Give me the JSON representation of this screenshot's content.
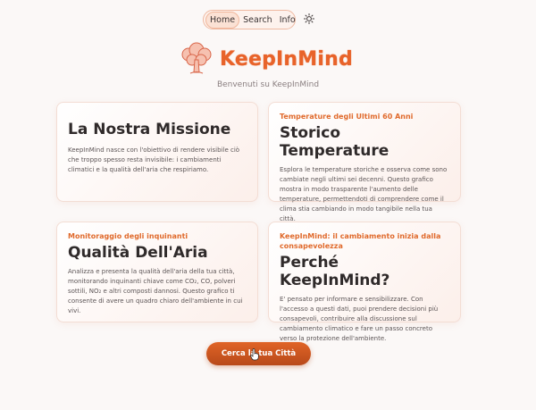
{
  "nav": {
    "items": [
      {
        "label": "Home",
        "active": true
      },
      {
        "label": "Search",
        "active": false
      },
      {
        "label": "Info",
        "active": false
      }
    ],
    "theme_toggle_icon": "sun-icon"
  },
  "header": {
    "logo_icon": "tree-cloud-icon",
    "brand": "KeepInMind",
    "welcome": "Benvenuti su KeepInMind"
  },
  "cards": [
    {
      "subtitle": "",
      "title": "La Nostra Missione",
      "body": "KeepInMind nasce con l'obiettivo di rendere visibile ciò che troppo spesso resta invisibile: i cambiamenti climatici e la qualità dell'aria che respiriamo."
    },
    {
      "subtitle": "Temperature degli Ultimi 60 Anni",
      "title": "Storico Temperature",
      "body": "Esplora le temperature storiche e osserva come sono cambiate negli ultimi sei decenni. Questo grafico mostra in modo trasparente l'aumento delle temperature, permettendoti di comprendere come il clima stia cambiando in modo tangibile nella tua città."
    },
    {
      "subtitle": "Monitoraggio degli inquinanti",
      "title": "Qualità Dell'Aria",
      "body": "Analizza e presenta la qualità dell'aria della tua città, monitorando inquinanti chiave come CO₂, CO, polveri sottili, NO₂ e altri composti dannosi. Questo grafico ti consente di avere un quadro chiaro dell'ambiente in cui vivi."
    },
    {
      "subtitle": "KeepInMind: il cambiamento inizia dalla consapevolezza",
      "title": "Perché KeepInMind?",
      "body": "E' pensato per informare e sensibilizzare. Con l'accesso a questi dati, puoi prendere decisioni più consapevoli, contribuire alla discussione sul cambiamento climatico e fare un passo concreto verso la protezione dell'ambiente."
    }
  ],
  "cta": {
    "label": "Cerca la tua Città"
  },
  "colors": {
    "accent": "#e8632a",
    "background": "#fbf8f7",
    "nav_border": "#efb9a1"
  }
}
